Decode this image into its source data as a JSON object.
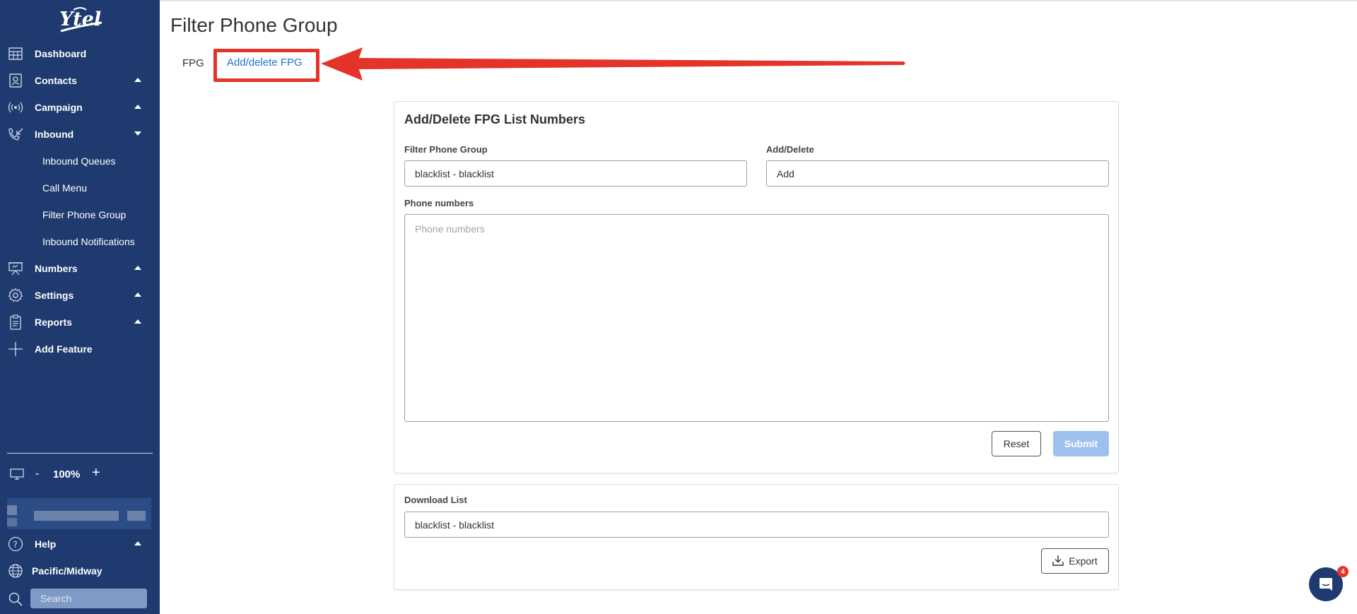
{
  "sidebar": {
    "logo_text": "Ytel",
    "items": [
      {
        "label": "Dashboard",
        "icon": "dashboard-icon"
      },
      {
        "label": "Contacts",
        "icon": "contacts-icon",
        "caret": "up"
      },
      {
        "label": "Campaign",
        "icon": "campaign-icon",
        "caret": "up"
      },
      {
        "label": "Inbound",
        "icon": "inbound-icon",
        "caret": "down"
      },
      {
        "label": "Numbers",
        "icon": "numbers-icon",
        "caret": "up"
      },
      {
        "label": "Settings",
        "icon": "gear-icon",
        "caret": "up"
      },
      {
        "label": "Reports",
        "icon": "reports-icon",
        "caret": "up"
      },
      {
        "label": "Add Feature",
        "icon": "plus-icon"
      }
    ],
    "inbound_subitems": [
      {
        "label": "Inbound Queues"
      },
      {
        "label": "Call Menu"
      },
      {
        "label": "Filter Phone Group"
      },
      {
        "label": "Inbound Notifications"
      }
    ],
    "zoom": {
      "minus": "-",
      "value": "100%",
      "plus": "+"
    },
    "help_label": "Help",
    "timezone_label": "Pacific/Midway",
    "search_placeholder": "Search"
  },
  "page": {
    "title": "Filter Phone Group",
    "tabs": [
      {
        "label": "FPG"
      },
      {
        "label": "Add/delete FPG"
      }
    ]
  },
  "form": {
    "title": "Add/Delete FPG List Numbers",
    "group_label": "Filter Phone Group",
    "group_value": "blacklist - blacklist",
    "action_label": "Add/Delete",
    "action_value": "Add",
    "phones_label": "Phone numbers",
    "phones_placeholder": "Phone numbers",
    "reset_label": "Reset",
    "submit_label": "Submit"
  },
  "download": {
    "label": "Download List",
    "value": "blacklist - blacklist",
    "export_label": "Export"
  },
  "chat": {
    "badge_count": "4"
  },
  "colors": {
    "sidebar_bg": "#1e3a6e",
    "accent": "#1a73d1",
    "highlight": "#e4342a",
    "submit_disabled": "#9dc0ee"
  }
}
